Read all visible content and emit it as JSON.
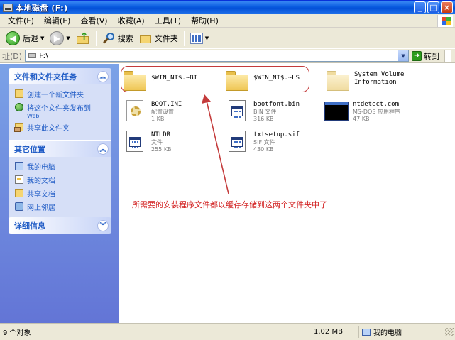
{
  "window": {
    "title": "本地磁盘 (F:)",
    "minimize": "_",
    "maximize": "□",
    "close": "×"
  },
  "menu": [
    "文件(F)",
    "编辑(E)",
    "查看(V)",
    "收藏(A)",
    "工具(T)",
    "帮助(H)"
  ],
  "toolbar": {
    "back": "后退",
    "search": "搜索",
    "folders": "文件夹"
  },
  "address": {
    "label": "址(D)",
    "value": "F:\\",
    "go": "转到"
  },
  "tasks": {
    "file_tasks": {
      "title": "文件和文件夹任务",
      "items": [
        {
          "label": "创建一个新文件夹",
          "icon": "new-folder-icon"
        },
        {
          "label": "将这个文件夹发布到",
          "sub": "Web",
          "icon": "globe-icon"
        },
        {
          "label": "共享此文件夹",
          "icon": "share-icon"
        }
      ]
    },
    "other_places": {
      "title": "其它位置",
      "items": [
        {
          "label": "我的电脑",
          "icon": "my-computer-icon"
        },
        {
          "label": "我的文档",
          "icon": "my-documents-icon"
        },
        {
          "label": "共享文档",
          "icon": "shared-documents-icon"
        },
        {
          "label": "网上邻居",
          "icon": "network-icon"
        }
      ]
    },
    "details": {
      "title": "详细信息"
    }
  },
  "files": [
    {
      "name": "$WIN_NT$.~BT",
      "type": "",
      "size": "",
      "icon": "folder-icon"
    },
    {
      "name": "$WIN_NT$.~LS",
      "type": "",
      "size": "",
      "icon": "folder-icon"
    },
    {
      "name": "System Volume Information",
      "type": "",
      "size": "",
      "icon": "system-folder-icon"
    },
    {
      "name": "BOOT.INI",
      "type": "配置设置",
      "size": "1 KB",
      "icon": "ini-file-icon"
    },
    {
      "name": "bootfont.bin",
      "type": "BIN 文件",
      "size": "316 KB",
      "icon": "bin-file-icon"
    },
    {
      "name": "ntdetect.com",
      "type": "MS-DOS 应用程序",
      "size": "47 KB",
      "icon": "msdos-app-icon"
    },
    {
      "name": "NTLDR",
      "type": "文件",
      "size": "255 KB",
      "icon": "system-file-icon"
    },
    {
      "name": "txtsetup.sif",
      "type": "SIF 文件",
      "size": "430 KB",
      "icon": "sif-file-icon"
    }
  ],
  "annotation": "所需要的安装程序文件都以缓存存储到这两个文件夹中了",
  "status": {
    "objects": "9 个对象",
    "size": "1.02 MB",
    "location": "我的电脑"
  },
  "colors": {
    "annotation": "#d21f1f",
    "highlight": "#c43b3b",
    "link": "#215dc6"
  }
}
